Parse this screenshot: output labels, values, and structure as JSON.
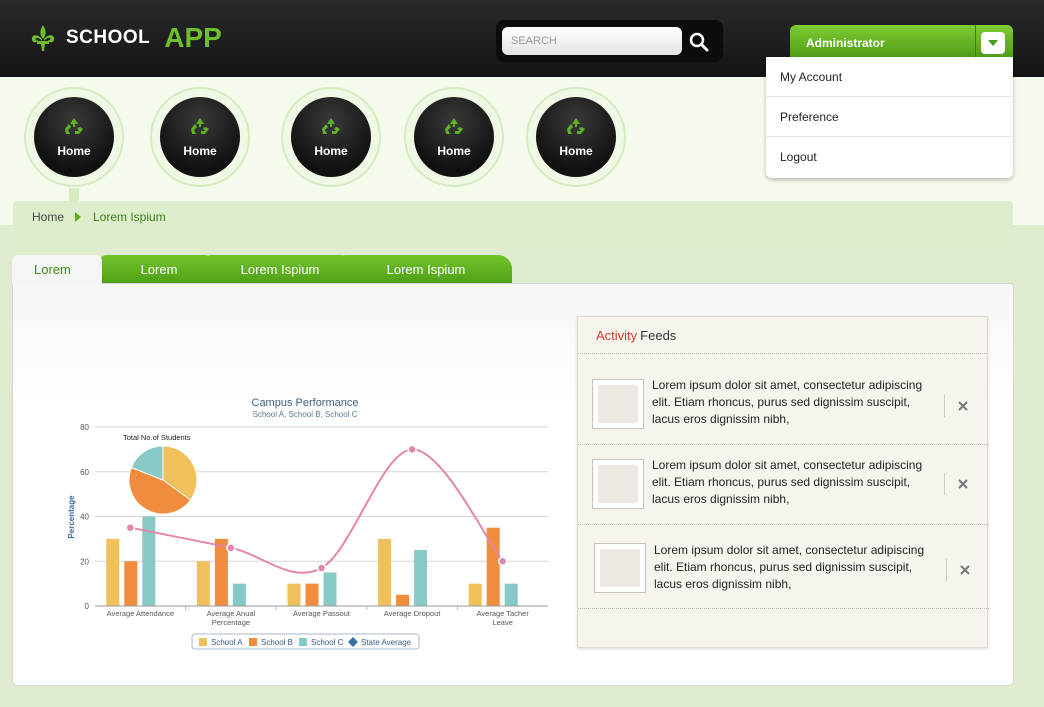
{
  "header": {
    "logo_text1": "SCHOOL",
    "logo_text2": "APP",
    "search_placeholder": "SEARCH",
    "admin_label": "Administrator"
  },
  "dropdown": {
    "items": [
      "My Account",
      "Preference",
      "Logout"
    ]
  },
  "nav": {
    "items": [
      "Home",
      "Home",
      "Home",
      "Home",
      "Home"
    ]
  },
  "breadcrumb": {
    "home": "Home",
    "current": "Lorem Ispium"
  },
  "tabs": [
    "Lorem",
    "Lorem",
    "Lorem Ispium",
    "Lorem Ispium"
  ],
  "activity": {
    "title_red": "Activity",
    "title_rest": "Feeds",
    "feeds": [
      "Lorem ipsum dolor sit amet, consectetur adipiscing elit. Etiam rhoncus, purus sed dignissim suscipit, lacus eros dignissim nibh,",
      "Lorem ipsum dolor sit amet, consectetur adipiscing elit. Etiam rhoncus, purus sed dignissim suscipit, lacus eros dignissim nibh,",
      "Lorem ipsum dolor sit amet, consectetur adipiscing elit. Etiam rhoncus, purus sed dignissim suscipit, lacus eros dignissim nibh,"
    ]
  },
  "colors": {
    "accent": "#5aae1d",
    "header": "#1b1b1b",
    "schoolA": "#f0c05a",
    "schoolB": "#f08c3c",
    "schoolC": "#86c9c5",
    "stateAvg": "#e585a8"
  },
  "chart_data": {
    "type": "bar",
    "title": "Campus Performance",
    "subtitle": "School A, School B, School C",
    "ylabel": "Percentage",
    "ylim": [
      0,
      80
    ],
    "yticks": [
      0,
      20,
      40,
      60,
      80
    ],
    "categories": [
      "Average Attendance",
      "Average Anual Percentage",
      "Average Passout",
      "Average Dropout",
      "Average Tacher Leave"
    ],
    "series": [
      {
        "name": "School A",
        "values": [
          30,
          20,
          10,
          30,
          10
        ]
      },
      {
        "name": "School B",
        "values": [
          20,
          30,
          10,
          5,
          35
        ]
      },
      {
        "name": "School C",
        "values": [
          40,
          10,
          15,
          25,
          10
        ]
      }
    ],
    "line_series": {
      "name": "State Average",
      "values": [
        35,
        26,
        17,
        70,
        20
      ]
    },
    "pie": {
      "title": "Total No.of Students",
      "slices": [
        {
          "name": "School A",
          "value": 35
        },
        {
          "name": "School B",
          "value": 46
        },
        {
          "name": "School C",
          "value": 19
        }
      ]
    }
  }
}
